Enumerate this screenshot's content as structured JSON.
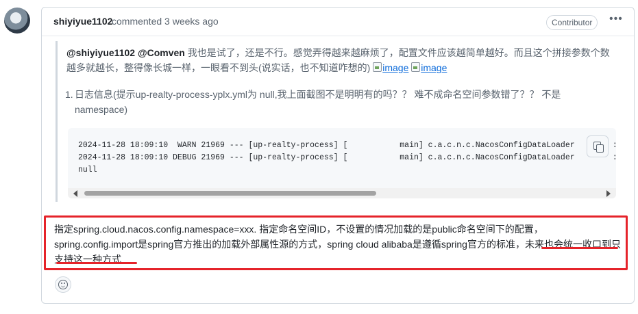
{
  "comment": {
    "author": "shiyiyue1102",
    "action": "commented 3 weeks ago",
    "badge": "Contributor",
    "menu_icon": "kebab-horizontal-icon"
  },
  "quote": {
    "mention1": "@shiyiyue1102",
    "mention2": "@Comven",
    "text": " 我也是试了，还是不行。感觉弄得越来越麻烦了，配置文件应该越简单越好。而且这个拼接参数个数越多就越长，整得像长城一样，一眼看不到头(说实话，也不知道咋想的) ",
    "image_link_1": "image",
    "image_link_2": "image",
    "list_number": "1.",
    "list_text": "日志信息(提示up-realty-process-yplx.yml为 null,我上面截图不是明明有的吗？？ 难不成命名空间参数错了？？ 不是namespace)",
    "code_lines": [
      "2024-11-28 18:09:10  WARN 21969 --- [up-realty-process] [           main] c.a.c.n.c.NacosConfigDataLoader        :",
      "2024-11-28 18:09:10 DEBUG 21969 --- [up-realty-process] [           main] c.a.c.n.c.NacosConfigDataLoader        :",
      "null"
    ]
  },
  "reply": {
    "text_main": "指定spring.cloud.nacos.config.namespace=xxx. 指定命名空间ID，不设置的情况加载的是public命名空间下的配置，spring.config.import是spring官方推出的加载外部属性源的方式，spring cloud alibaba是遵循spring官方的标准，",
    "text_highlight": "未来也会统一收口到只支持这一种方式"
  },
  "reactions": {
    "icon": "smiley-icon"
  },
  "colors": {
    "highlight_border": "#e5232a",
    "link": "#0969da"
  }
}
